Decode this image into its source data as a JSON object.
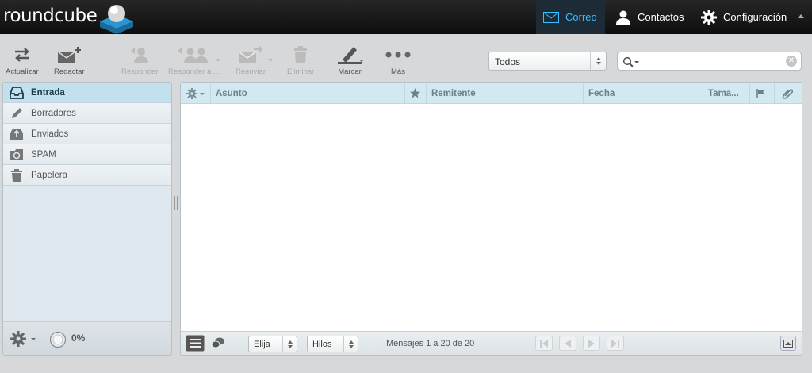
{
  "app": {
    "logo_text": "roundcube"
  },
  "topnav": {
    "mail": "Correo",
    "contacts": "Contactos",
    "settings": "Configuración"
  },
  "toolbar": {
    "refresh": "Actualizar",
    "compose": "Redactar",
    "reply": "Responder",
    "reply_all": "Responder a ...",
    "forward": "Reenviar",
    "delete": "Eliminar",
    "mark": "Marcar",
    "more": "Más"
  },
  "filter": {
    "selected": "Todos"
  },
  "search": {
    "placeholder": ""
  },
  "folders": [
    {
      "label": "Entrada",
      "icon": "inbox-icon",
      "selected": true
    },
    {
      "label": "Borradores",
      "icon": "pencil-icon",
      "selected": false
    },
    {
      "label": "Enviados",
      "icon": "sent-icon",
      "selected": false
    },
    {
      "label": "SPAM",
      "icon": "junk-icon",
      "selected": false
    },
    {
      "label": "Papelera",
      "icon": "trash-icon",
      "selected": false
    }
  ],
  "quota": {
    "text": "0%"
  },
  "message_list": {
    "columns": {
      "subject": "Asunto",
      "from": "Remitente",
      "date": "Fecha",
      "size": "Tama..."
    },
    "rows": []
  },
  "footer": {
    "select_label": "Elija",
    "threads_label": "Hilos",
    "count_text": "Mensajes 1 a 20 de 20"
  },
  "colors": {
    "accent": "#37beff",
    "topbar": "#151515",
    "header_bg": "#d2e9f2"
  }
}
